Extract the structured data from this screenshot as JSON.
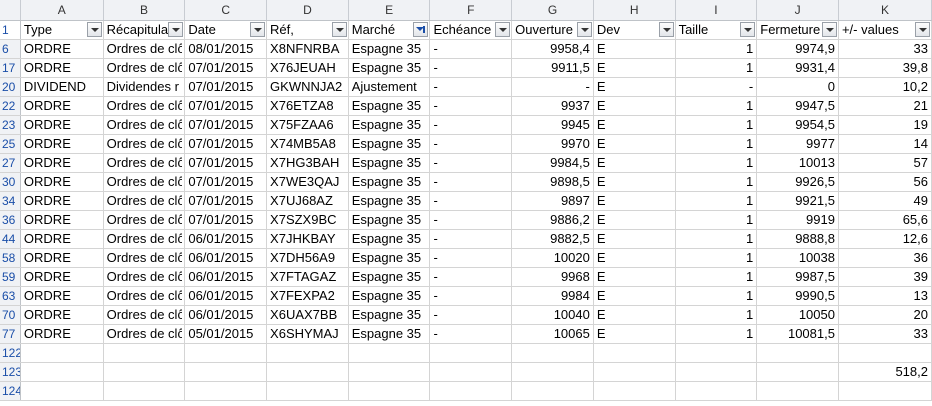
{
  "columns": [
    "A",
    "B",
    "C",
    "D",
    "E",
    "F",
    "G",
    "H",
    "I",
    "J",
    "K"
  ],
  "headers": [
    "Type",
    "Récapitulat",
    "Date",
    "Réf,",
    "Marché",
    "Echéance",
    "Ouverture",
    "Dev",
    "Taille",
    "Fermeture",
    "+/- values"
  ],
  "filtered_column_index": 4,
  "rows": [
    {
      "n": "6",
      "c": [
        "ORDRE",
        "Ordres de clô",
        "08/01/2015",
        "X8NFNRBA",
        "Espagne 35",
        "-",
        "9958,4",
        "E",
        "1",
        "9974,9",
        "33"
      ]
    },
    {
      "n": "17",
      "c": [
        "ORDRE",
        "Ordres de clô",
        "07/01/2015",
        "X76JEUAH",
        "Espagne 35",
        "-",
        "9911,5",
        "E",
        "1",
        "9931,4",
        "39,8"
      ]
    },
    {
      "n": "20",
      "c": [
        "DIVIDEND",
        "Dividendes r",
        "07/01/2015",
        "GKWNNJA2",
        "Ajustement",
        "-",
        "-",
        "E",
        "-",
        "0",
        "10,2"
      ]
    },
    {
      "n": "22",
      "c": [
        "ORDRE",
        "Ordres de clô",
        "07/01/2015",
        "X76ETZA8",
        "Espagne 35",
        "-",
        "9937",
        "E",
        "1",
        "9947,5",
        "21"
      ]
    },
    {
      "n": "23",
      "c": [
        "ORDRE",
        "Ordres de clô",
        "07/01/2015",
        "X75FZAA6",
        "Espagne 35",
        "-",
        "9945",
        "E",
        "1",
        "9954,5",
        "19"
      ]
    },
    {
      "n": "25",
      "c": [
        "ORDRE",
        "Ordres de clô",
        "07/01/2015",
        "X74MB5A8",
        "Espagne 35",
        "-",
        "9970",
        "E",
        "1",
        "9977",
        "14"
      ]
    },
    {
      "n": "27",
      "c": [
        "ORDRE",
        "Ordres de clô",
        "07/01/2015",
        "X7HG3BAH",
        "Espagne 35",
        "-",
        "9984,5",
        "E",
        "1",
        "10013",
        "57"
      ]
    },
    {
      "n": "30",
      "c": [
        "ORDRE",
        "Ordres de clô",
        "07/01/2015",
        "X7WE3QAJ",
        "Espagne 35",
        "-",
        "9898,5",
        "E",
        "1",
        "9926,5",
        "56"
      ]
    },
    {
      "n": "34",
      "c": [
        "ORDRE",
        "Ordres de clô",
        "07/01/2015",
        "X7UJ68AZ",
        "Espagne 35",
        "-",
        "9897",
        "E",
        "1",
        "9921,5",
        "49"
      ]
    },
    {
      "n": "36",
      "c": [
        "ORDRE",
        "Ordres de clô",
        "07/01/2015",
        "X7SZX9BC",
        "Espagne 35",
        "-",
        "9886,2",
        "E",
        "1",
        "9919",
        "65,6"
      ]
    },
    {
      "n": "44",
      "c": [
        "ORDRE",
        "Ordres de clô",
        "06/01/2015",
        "X7JHKBAY",
        "Espagne 35",
        "-",
        "9882,5",
        "E",
        "1",
        "9888,8",
        "12,6"
      ]
    },
    {
      "n": "58",
      "c": [
        "ORDRE",
        "Ordres de clô",
        "06/01/2015",
        "X7DH56A9",
        "Espagne 35",
        "-",
        "10020",
        "E",
        "1",
        "10038",
        "36"
      ]
    },
    {
      "n": "59",
      "c": [
        "ORDRE",
        "Ordres de clô",
        "06/01/2015",
        "X7FTAGAZ",
        "Espagne 35",
        "-",
        "9968",
        "E",
        "1",
        "9987,5",
        "39"
      ]
    },
    {
      "n": "63",
      "c": [
        "ORDRE",
        "Ordres de clô",
        "06/01/2015",
        "X7FEXPA2",
        "Espagne 35",
        "-",
        "9984",
        "E",
        "1",
        "9990,5",
        "13"
      ]
    },
    {
      "n": "70",
      "c": [
        "ORDRE",
        "Ordres de clô",
        "06/01/2015",
        "X6UAX7BB",
        "Espagne 35",
        "-",
        "10040",
        "E",
        "1",
        "10050",
        "20"
      ]
    },
    {
      "n": "77",
      "c": [
        "ORDRE",
        "Ordres de clô",
        "05/01/2015",
        "X6SHYMAJ",
        "Espagne 35",
        "-",
        "10065",
        "E",
        "1",
        "10081,5",
        "33"
      ]
    },
    {
      "n": "122",
      "c": [
        "",
        "",
        "",
        "",
        "",
        "",
        "",
        "",
        "",
        "",
        ""
      ]
    },
    {
      "n": "123",
      "c": [
        "",
        "",
        "",
        "",
        "",
        "",
        "",
        "",
        "",
        "",
        "518,2"
      ]
    },
    {
      "n": "124",
      "c": [
        "",
        "",
        "",
        "",
        "",
        "",
        "",
        "",
        "",
        "",
        ""
      ]
    }
  ],
  "header_row_number": "1"
}
